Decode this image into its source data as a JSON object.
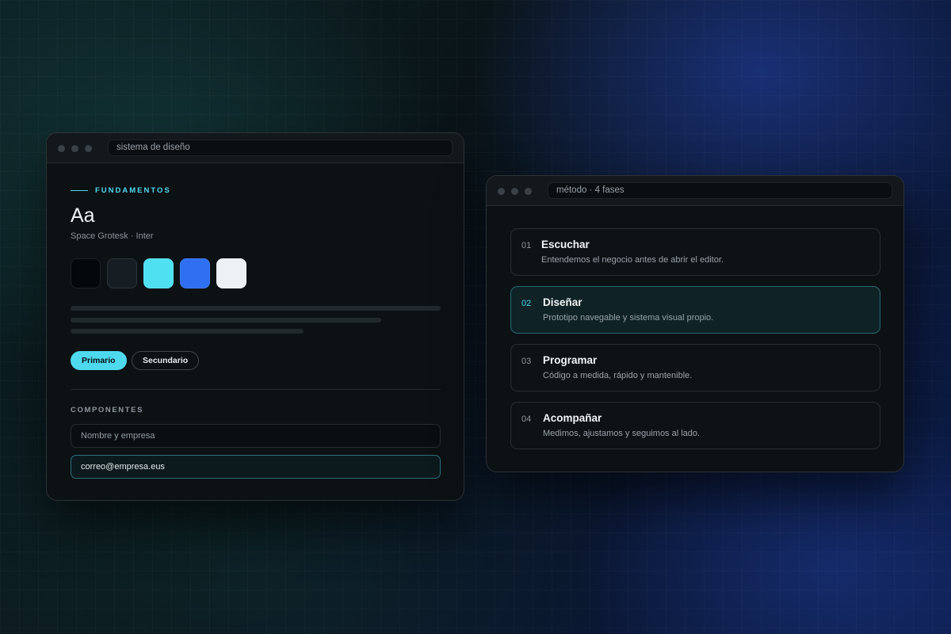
{
  "left_window": {
    "url": "sistema de diseño",
    "eyebrow": "FUNDAMENTOS",
    "type_sample": "Aa",
    "type_caption": "Space Grotesk · Inter",
    "swatches": [
      "#05080a",
      "#161d23",
      "#4fe0f2",
      "#2f6ff2",
      "#eef1f4"
    ],
    "primary_button": "Primario",
    "secondary_button": "Secundario",
    "components_label": "COMPONENTES",
    "name_field": {
      "placeholder": "Nombre y empresa"
    },
    "email_field": {
      "value": "correo@empresa.eus"
    }
  },
  "right_window": {
    "url": "método · 4 fases",
    "steps": [
      {
        "num": "01",
        "title": "Escuchar",
        "desc": "Entendemos el negocio antes de abrir el editor.",
        "active": false
      },
      {
        "num": "02",
        "title": "Diseñar",
        "desc": "Prototipo navegable y sistema visual propio.",
        "active": true
      },
      {
        "num": "03",
        "title": "Programar",
        "desc": "Código a medida, rápido y mantenible.",
        "active": false
      },
      {
        "num": "04",
        "title": "Acompañar",
        "desc": "Medimos, ajustamos y seguimos al lado.",
        "active": false
      }
    ]
  },
  "colors": {
    "accent": "#4fd9ee",
    "panel": "#0c1114"
  }
}
